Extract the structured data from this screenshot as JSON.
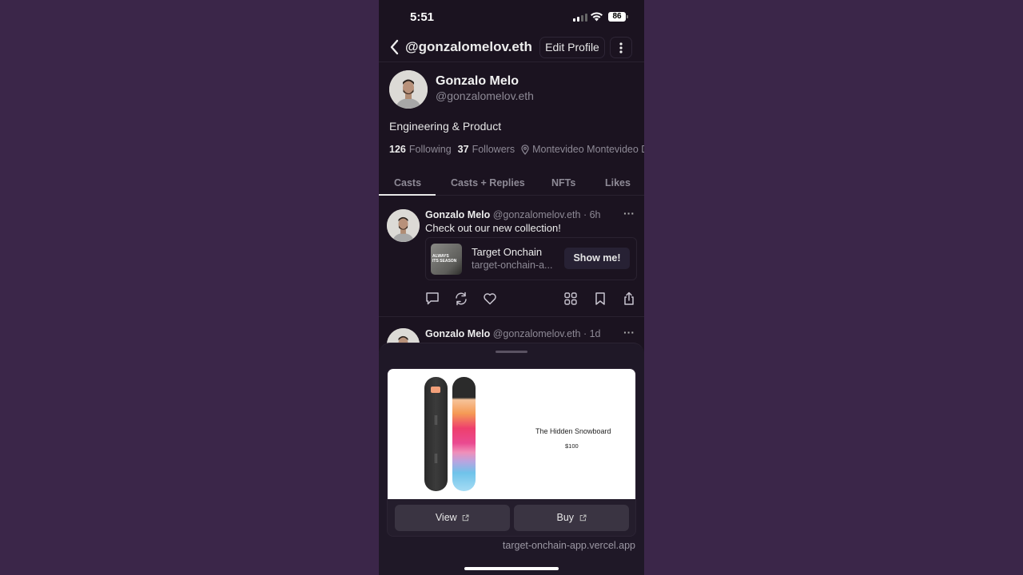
{
  "status_bar": {
    "time": "5:51",
    "battery": "86"
  },
  "header": {
    "title": "@gonzalomelov.eth",
    "edit_label": "Edit Profile"
  },
  "profile": {
    "name": "Gonzalo Melo",
    "handle": "@gonzalomelov.eth",
    "bio": "Engineering & Product",
    "following_count": "126",
    "following_label": "Following",
    "followers_count": "37",
    "followers_label": "Followers",
    "location": "Montevideo Montevideo D"
  },
  "tabs": [
    {
      "label": "Casts",
      "active": true
    },
    {
      "label": "Casts + Replies"
    },
    {
      "label": "NFTs"
    },
    {
      "label": "Likes"
    }
  ],
  "casts": [
    {
      "author": "Gonzalo Melo",
      "meta": "@gonzalomelov.eth · 6h",
      "text": "Check out our new collection!",
      "embed": {
        "title": "Target Onchain",
        "subtitle": "target-onchain-a...",
        "thumb_text": "ALWAYS\nITS SEASON",
        "button": "Show me!"
      }
    },
    {
      "author": "Gonzalo Melo",
      "meta": "@gonzalomelov.eth · 1d"
    }
  ],
  "frame": {
    "product_name": "The Hidden Snowboard",
    "product_price": "$100",
    "buttons": [
      {
        "label": "View"
      },
      {
        "label": "Buy"
      }
    ],
    "url": "target-onchain-app.vercel.app"
  }
}
